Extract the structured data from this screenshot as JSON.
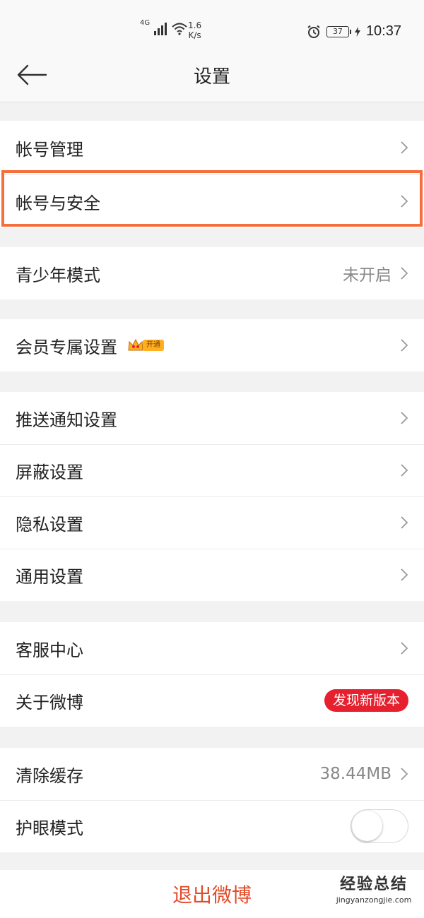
{
  "status_bar": {
    "network": "4G",
    "speed_value": "1.6",
    "speed_unit": "K/s",
    "battery": "37",
    "time": "10:37"
  },
  "nav": {
    "title": "设置"
  },
  "groups": [
    {
      "items": [
        {
          "label": "帐号管理"
        },
        {
          "label": "帐号与安全"
        }
      ]
    },
    {
      "items": [
        {
          "label": "青少年模式",
          "value": "未开启"
        }
      ]
    },
    {
      "items": [
        {
          "label": "会员专属设置",
          "badge": "开通"
        }
      ]
    },
    {
      "items": [
        {
          "label": "推送通知设置"
        },
        {
          "label": "屏蔽设置"
        },
        {
          "label": "隐私设置"
        },
        {
          "label": "通用设置"
        }
      ]
    },
    {
      "items": [
        {
          "label": "客服中心"
        },
        {
          "label": "关于微博",
          "badge": "发现新版本"
        }
      ]
    },
    {
      "items": [
        {
          "label": "清除缓存",
          "value": "38.44MB"
        },
        {
          "label": "护眼模式",
          "toggle_on": false
        }
      ]
    }
  ],
  "logout": {
    "label": "退出微博"
  },
  "watermark": {
    "main": "经验总结",
    "url": "jingyanzongjie.com"
  },
  "colors": {
    "highlight": "#f56e3c",
    "logout_text": "#e24a29",
    "update_badge": "#e6202e"
  }
}
